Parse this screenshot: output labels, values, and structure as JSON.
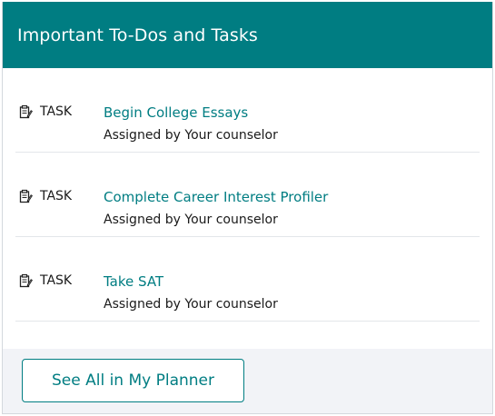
{
  "header": {
    "title": "Important To-Dos and Tasks"
  },
  "tasks": [
    {
      "type_label": "TASK",
      "icon": "clipboard-icon",
      "title": "Begin College Essays",
      "assigned": "Assigned by Your counselor"
    },
    {
      "type_label": "TASK",
      "icon": "clipboard-icon",
      "title": "Complete Career Interest Profiler",
      "assigned": "Assigned by Your counselor"
    },
    {
      "type_label": "TASK",
      "icon": "clipboard-icon",
      "title": "Take SAT",
      "assigned": "Assigned by Your counselor"
    }
  ],
  "footer": {
    "button_label": "See All in My Planner"
  },
  "colors": {
    "accent": "#007d82",
    "footer_bg": "#f2f3f7",
    "divider": "#e3e6ea"
  }
}
